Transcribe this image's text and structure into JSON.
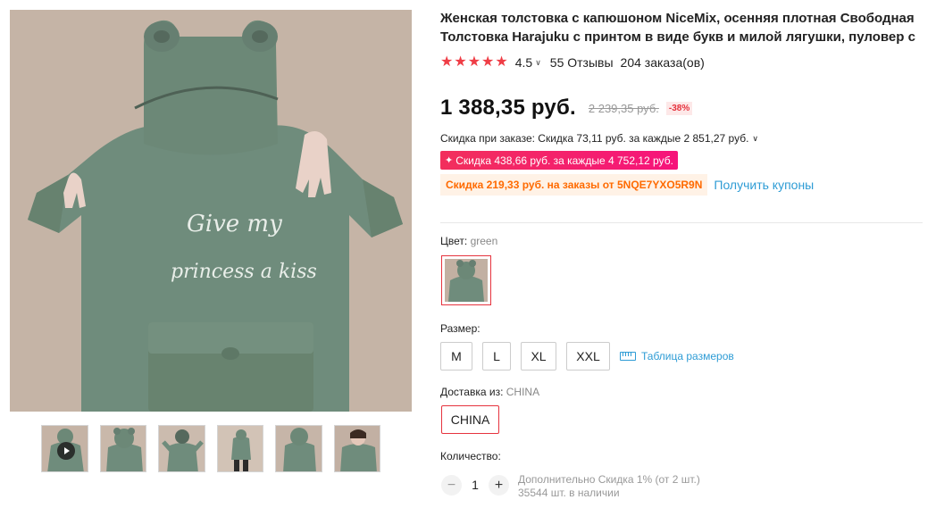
{
  "product": {
    "title": "Женская толстовка с капюшоном NiceMix, осенняя плотная Свободная Толстовка Harajuku с принтом в виде букв и милой лягушки, пуловер с капюшоном",
    "rating": "4.5",
    "reviews": "55 Отзывы",
    "orders": "204 заказа(ов)",
    "stars": [
      "★",
      "★",
      "★",
      "★",
      "★"
    ],
    "image_alt_print_line1": "Give my",
    "image_alt_print_line2": "princess a kiss"
  },
  "price": {
    "current": "1 388,35 руб.",
    "old": "2 239,35 руб.",
    "discount": "-38%"
  },
  "discounts": {
    "order_discount": "Скидка при заказе: Скидка 73,11 руб. за каждые 2 851,27 руб.",
    "promo_badge": "Скидка 438,66 руб. за каждые 4 752,12 руб.",
    "coupon_tag": "Скидка 219,33 руб. на заказы от 5NQE7YXO5R9N",
    "coupon_link": "Получить купоны"
  },
  "color": {
    "label": "Цвет: ",
    "value": "green"
  },
  "size": {
    "label": "Размер:",
    "options": [
      "M",
      "L",
      "XL",
      "XXL"
    ],
    "chart_link": "Таблица размеров"
  },
  "shipping": {
    "label": "Доставка из: ",
    "value": "CHINA",
    "selected": "CHINA"
  },
  "quantity": {
    "label": "Количество:",
    "value": "1",
    "minus": "−",
    "plus": "+",
    "note_line1": "Дополнительно Скидка 1% (от 2 шт.)",
    "note_line2": "35544 шт. в наличии"
  },
  "colors": {
    "accent_red": "#e6333e",
    "link_blue": "#2e9cd5",
    "coupon_orange": "#ff6a00",
    "hoodie_green": "#6f8c7c"
  }
}
